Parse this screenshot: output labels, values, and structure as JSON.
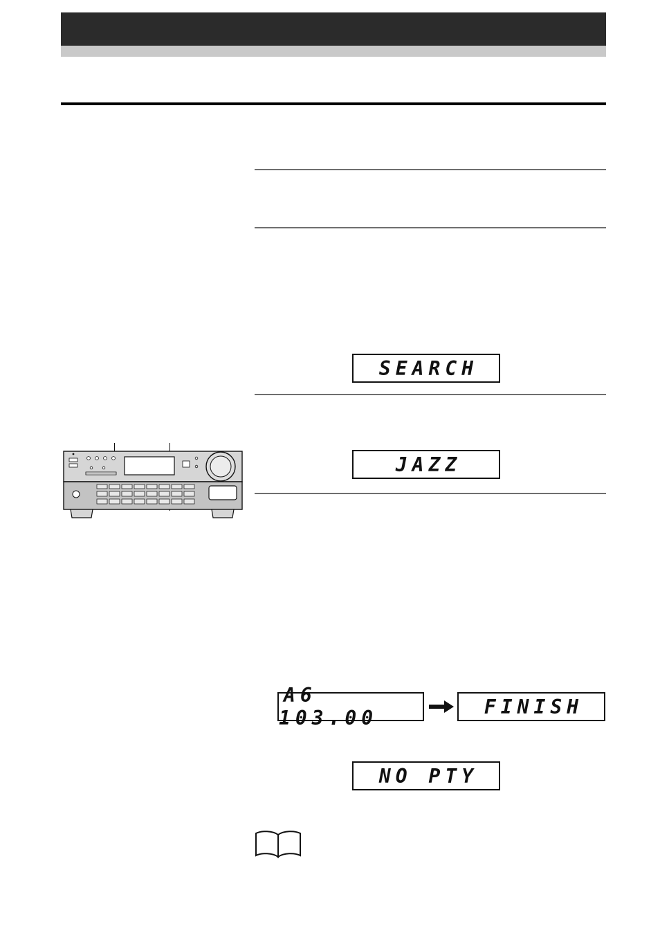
{
  "page": {
    "header": {
      "black_bar_label": "",
      "gray_bar_label": ""
    },
    "displays": {
      "search": "SEARCH",
      "jazz": "JAZZ",
      "frequency": "A6  103.00",
      "finish": "FINISH",
      "no_pty": "NO PTY"
    },
    "icons": {
      "arrow": "right-arrow-icon",
      "book": "book-icon",
      "receiver": "stereo-receiver-illustration"
    }
  }
}
